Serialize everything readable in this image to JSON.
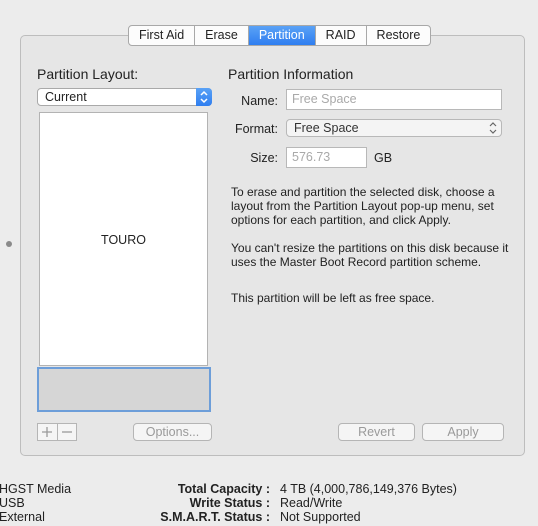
{
  "tabs": [
    {
      "label": "First Aid",
      "active": false
    },
    {
      "label": "Erase",
      "active": false
    },
    {
      "label": "Partition",
      "active": true
    },
    {
      "label": "RAID",
      "active": false
    },
    {
      "label": "Restore",
      "active": false
    }
  ],
  "layout": {
    "heading": "Partition Layout:",
    "selected": "Current",
    "disk_label": "TOURO"
  },
  "info": {
    "heading": "Partition Information",
    "name_label": "Name:",
    "name_placeholder": "Free Space",
    "format_label": "Format:",
    "format_value": "Free Space",
    "size_label": "Size:",
    "size_value": "576.73",
    "size_unit": "GB",
    "para1": "To erase and partition the selected disk, choose a layout from the Partition Layout pop-up menu, set options for each partition, and click Apply.",
    "para2": "You can't resize the partitions on this disk because it uses the Master Boot Record partition scheme.",
    "para3": "This partition will be left as free space."
  },
  "buttons": {
    "add": "+",
    "remove": "−",
    "options": "Options...",
    "revert": "Revert",
    "apply": "Apply"
  },
  "footer": {
    "left": [
      "HGST Media",
      "USB",
      "External"
    ],
    "rows": [
      {
        "label": "Total Capacity :",
        "value": "4 TB (4,000,786,149,376 Bytes)"
      },
      {
        "label": "Write Status :",
        "value": "Read/Write"
      },
      {
        "label": "S.M.A.R.T. Status :",
        "value": "Not Supported"
      }
    ]
  },
  "colors": {
    "accent": "#2f7ef0",
    "selection_border": "#6d9ed9"
  }
}
